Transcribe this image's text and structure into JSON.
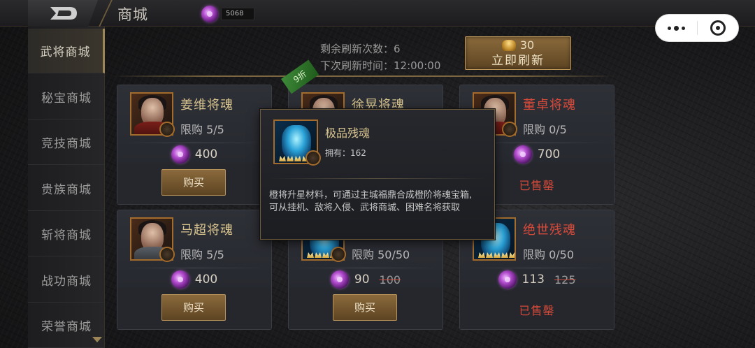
{
  "header": {
    "title": "商城",
    "currency_value": "5068"
  },
  "sidebar": {
    "items": [
      {
        "label": "武将商城",
        "active": true
      },
      {
        "label": "秘宝商城",
        "active": false
      },
      {
        "label": "竞技商城",
        "active": false
      },
      {
        "label": "贵族商城",
        "active": false
      },
      {
        "label": "斩将商城",
        "active": false
      },
      {
        "label": "战功商城",
        "active": false
      },
      {
        "label": "荣誉商城",
        "active": false
      }
    ]
  },
  "refresh": {
    "remaining_label": "剩余刷新次数：6",
    "next_time_label": "下次刷新时间：12:00:00",
    "cost": "30",
    "button_label": "立即刷新"
  },
  "discount_badge": "9折",
  "cards": [
    {
      "name": "姜维将魂",
      "limit": "限购   5/5",
      "price": "400",
      "old_price": "",
      "action": "购买",
      "sold_out": false,
      "name_color": "gold"
    },
    {
      "name": "徐晃将魂",
      "limit": "",
      "price": "",
      "old_price": "",
      "action": "",
      "sold_out": false,
      "name_color": "gold"
    },
    {
      "name": "董卓将魂",
      "limit": "限购   0/5",
      "price": "700",
      "old_price": "",
      "action": "已售罄",
      "sold_out": true,
      "name_color": "red"
    },
    {
      "name": "马超将魂",
      "limit": "限购   5/5",
      "price": "400",
      "old_price": "",
      "action": "购买",
      "sold_out": false,
      "name_color": "gold"
    },
    {
      "name": "",
      "limit": "限购   50/50",
      "price": "90",
      "old_price": "100",
      "action": "购买",
      "sold_out": false,
      "name_color": "gold"
    },
    {
      "name": "绝世残魂",
      "limit": "限购   0/50",
      "price": "113",
      "old_price": "125",
      "action": "已售罄",
      "sold_out": true,
      "name_color": "red"
    }
  ],
  "tooltip": {
    "name": "极品残魂",
    "owned": "拥有：162",
    "description_line1": "橙将升星材料，可通过主城福鼎合成橙阶将魂宝箱,",
    "description_line2": "可从挂机、敌将入侵、武将商城、困难名将获取"
  },
  "colors": {
    "accent_gold": "#9c8658",
    "sold_out_red": "#d24a3a",
    "name_gold": "#d7c38e"
  }
}
